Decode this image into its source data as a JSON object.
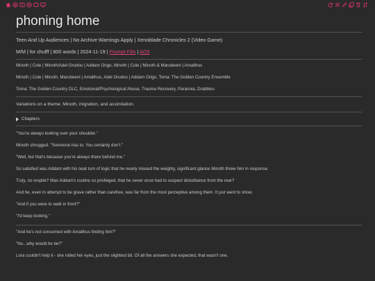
{
  "toolbar": {
    "left_icons": [
      "home-icon",
      "download-icon",
      "book-icon",
      "layers-icon",
      "archive-icon",
      "monitor-icon"
    ],
    "right_icons": [
      "refresh-icon",
      "shuffle-icon",
      "edit-icon",
      "copy-icon",
      "delete-icon",
      "sort-icon"
    ],
    "accent": "#d6336c"
  },
  "work": {
    "title": "phoning home",
    "rating_line": "Teen And Up Audiences | No Archive Warnings Apply | Xenoblade Chronicles 2 (Video Game)",
    "info_prefix": "M/M | for chufff | 800 words | 2024-11-19 |",
    "prompt_link": "Prompt Fills",
    "ao3_link": "AO3",
    "ships_line_1": "Minoth | Cole | Minoth/Adel Orudou | Addam Origo, Minoth | Cole | Minoth & Marubeeni | Amalthus",
    "ships_line_2": "Minoth | Cole | Minoth, Marubeeni | Amalthus, Adel Orudou | Addam Origo, Toma: The Golden Country Ensemble",
    "tags_line": "Toma: The Golden Country DLC, Emotional/Psychological Abuse, Trauma Recovery, Paranoia, Drabbles",
    "summary": "Variations on a theme: Minoth, migration, and assimilation.",
    "chapters_label": "Chapters"
  },
  "story": {
    "p1": "\"You're always looking over your shoulder.\"",
    "p2": "Minoth shrugged. \"Someone has to. You certainly don't.\"",
    "p3": "\"Well, but that's because you're always there behind me.\"",
    "p4": "So satisfied was Addam with his neat turn of logic that he nearly missed the weighty, significant glance Minoth threw him in response.",
    "p5": "Truly, no respite? Was Addam's routine so privileged, that he never once had to suspect disturbance from the rear?",
    "p6": "And he, even in attempt to be grave rather than carefree, was far from the most perceptive among them. It just went to show.",
    "p7": "\"And if you were to walk in front?\"",
    "p8": "\"I'd keep looking.\"",
    "p9": "\"And he's not concerned with Amalthus finding him?\"",
    "p10": "\"No...why would he be?\"",
    "p11": "Lora couldn't help it - she rolled her eyes, just the slightest bit. Of all the answers she expected, that wasn't one."
  }
}
